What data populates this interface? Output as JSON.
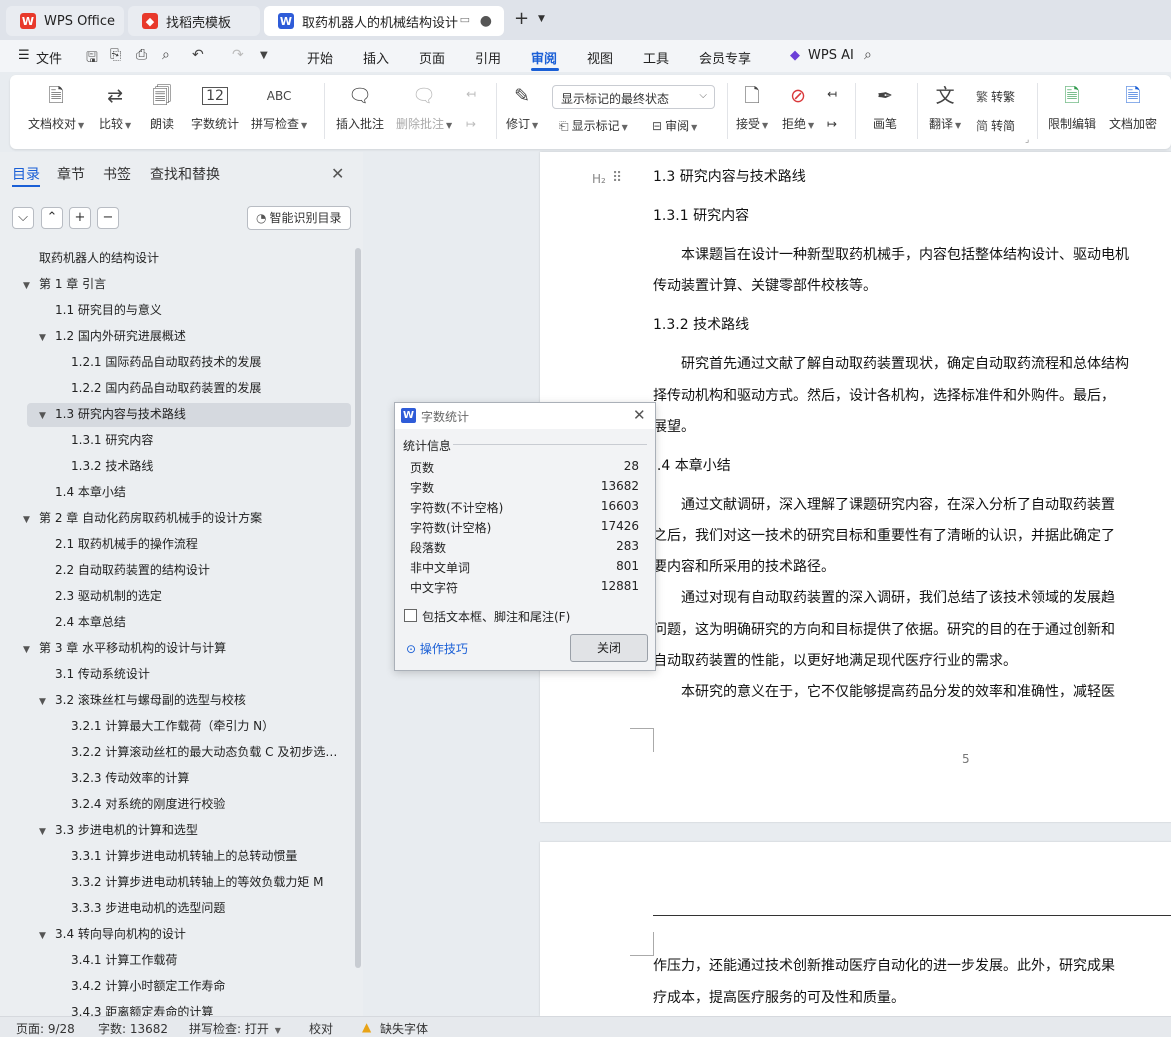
{
  "tabs": [
    {
      "label": "WPS Office",
      "icon": "wps-logo-icon"
    },
    {
      "label": "找稻壳模板",
      "icon": "docer-icon"
    },
    {
      "label": "取药机器人的机械结构设计 说",
      "icon": "word-doc-icon"
    }
  ],
  "menu": {
    "file": "文件",
    "items": [
      "开始",
      "插入",
      "页面",
      "引用",
      "审阅",
      "视图",
      "工具",
      "会员专享"
    ],
    "active": "审阅",
    "ai": "WPS AI"
  },
  "ribbon": {
    "doc_check": "文档校对",
    "compare": "比较",
    "read_aloud": "朗读",
    "word_count": "字数统计",
    "spell_check": "拼写检查",
    "insert_comment": "插入批注",
    "delete_comment": "删除批注",
    "revise": "修订",
    "mark_state": "显示标记的最终状态",
    "show_marks": "显示标记",
    "review": "审阅",
    "accept": "接受",
    "reject": "拒绝",
    "pen": "画笔",
    "translate": "翻译",
    "to_traditional": "转繁",
    "to_simplified": "转简",
    "restrict_edit": "限制编辑",
    "encrypt": "文档加密",
    "wordcount_icon_text": "12",
    "spell_icon_text": "ABC"
  },
  "sidebar": {
    "tabs": [
      "目录",
      "章节",
      "书签",
      "查找和替换"
    ],
    "smart_toc": "智能识别目录",
    "toc": [
      {
        "text": "取药机器人的结构设计",
        "level": 0,
        "arrow": ""
      },
      {
        "text": "第 1 章  引言",
        "level": 0,
        "arrow": "▼"
      },
      {
        "text": "1.1  研究目的与意义",
        "level": 1,
        "arrow": ""
      },
      {
        "text": "1.2  国内外研究进展概述",
        "level": 1,
        "arrow": "▼"
      },
      {
        "text": "1.2.1  国际药品自动取药技术的发展",
        "level": 2,
        "arrow": ""
      },
      {
        "text": "1.2.2  国内药品自动取药装置的发展",
        "level": 2,
        "arrow": ""
      },
      {
        "text": "1.3  研究内容与技术路线",
        "level": 1,
        "arrow": "▼"
      },
      {
        "text": "1.3.1  研究内容",
        "level": 2,
        "arrow": ""
      },
      {
        "text": "1.3.2  技术路线",
        "level": 2,
        "arrow": ""
      },
      {
        "text": "1.4  本章小结",
        "level": 1,
        "arrow": ""
      },
      {
        "text": "第 2 章  自动化药房取药机械手的设计方案",
        "level": 0,
        "arrow": "▼"
      },
      {
        "text": "2.1  取药机械手的操作流程",
        "level": 1,
        "arrow": ""
      },
      {
        "text": "2.2  自动取药装置的结构设计",
        "level": 1,
        "arrow": ""
      },
      {
        "text": "2.3  驱动机制的选定",
        "level": 1,
        "arrow": ""
      },
      {
        "text": "2.4  本章总结",
        "level": 1,
        "arrow": ""
      },
      {
        "text": "第 3 章  水平移动机构的设计与计算",
        "level": 0,
        "arrow": "▼"
      },
      {
        "text": "3.1  传动系统设计",
        "level": 1,
        "arrow": ""
      },
      {
        "text": "3.2  滚珠丝杠与螺母副的选型与校核",
        "level": 1,
        "arrow": "▼"
      },
      {
        "text": "3.2.1  计算最大工作载荷（牵引力 N）",
        "level": 2,
        "arrow": ""
      },
      {
        "text": "3.2.2  计算滚动丝杠的最大动态负载 C 及初步选…",
        "level": 2,
        "arrow": ""
      },
      {
        "text": "3.2.3  传动效率的计算",
        "level": 2,
        "arrow": ""
      },
      {
        "text": "3.2.4 对系统的刚度进行校验",
        "level": 2,
        "arrow": ""
      },
      {
        "text": "3.3 步进电机的计算和选型",
        "level": 1,
        "arrow": "▼"
      },
      {
        "text": "3.3.1 计算步进电动机转轴上的总转动惯量",
        "level": 2,
        "arrow": ""
      },
      {
        "text": "3.3.2 计算步进电动机转轴上的等效负载力矩 M",
        "level": 2,
        "arrow": ""
      },
      {
        "text": "3.3.3 步进电动机的选型问题",
        "level": 2,
        "arrow": ""
      },
      {
        "text": "3.4 转向导向机构的设计",
        "level": 1,
        "arrow": "▼"
      },
      {
        "text": "3.4.1 计算工作载荷",
        "level": 2,
        "arrow": ""
      },
      {
        "text": "3.4.2 计算小时额定工作寿命",
        "level": 2,
        "arrow": ""
      },
      {
        "text": "3.4.3 距离额定寿命的计算",
        "level": 2,
        "arrow": ""
      }
    ]
  },
  "document": {
    "heading_marker": "H₂",
    "page1": [
      {
        "type": "h",
        "text": "1.3  研究内容与技术路线"
      },
      {
        "type": "h",
        "text": "1.3.1  研究内容"
      },
      {
        "type": "p",
        "text": "本课题旨在设计一种新型取药机械手，内容包括整体结构设计、驱动电机"
      },
      {
        "type": "c",
        "text": "传动装置计算、关键零部件校核等。"
      },
      {
        "type": "h",
        "text": "1.3.2  技术路线"
      },
      {
        "type": "p",
        "text": "研究首先通过文献了解自动取药装置现状，确定自动取药流程和总体结构"
      },
      {
        "type": "c",
        "text": "择传动机构和驱动方式。然后，设计各机构，选择标准件和外购件。最后，"
      },
      {
        "type": "c",
        "text": "展望。"
      },
      {
        "type": "h",
        "text": "1.4  本章小结"
      },
      {
        "type": "p",
        "text": "通过文献调研，深入理解了课题研究内容，在深入分析了自动取药装置"
      },
      {
        "type": "c",
        "text": "之后，我们对这一技术的研究目标和重要性有了清晰的认识，并据此确定了"
      },
      {
        "type": "c",
        "text": "要内容和所采用的技术路径。"
      },
      {
        "type": "p",
        "text": "通过对现有自动取药装置的深入调研，我们总结了该技术领域的发展趋"
      },
      {
        "type": "c",
        "text": "问题，这为明确研究的方向和目标提供了依据。研究的目的在于通过创新和"
      },
      {
        "type": "c",
        "text": "自动取药装置的性能，以更好地满足现代医疗行业的需求。"
      },
      {
        "type": "p",
        "text": "本研究的意义在于，它不仅能够提高药品分发的效率和准确性，减轻医"
      }
    ],
    "page_number": "5",
    "page2": [
      "作压力，还能通过技术创新推动医疗自动化的进一步发展。此外，研究成果",
      "疗成本，提高医疗服务的可及性和质量。"
    ]
  },
  "dialog": {
    "title": "字数统计",
    "group": "统计信息",
    "stats": [
      {
        "label": "页数",
        "value": "28"
      },
      {
        "label": "字数",
        "value": "13682"
      },
      {
        "label": "字符数(不计空格)",
        "value": "16603"
      },
      {
        "label": "字符数(计空格)",
        "value": "17426"
      },
      {
        "label": "段落数",
        "value": "283"
      },
      {
        "label": "非中文单词",
        "value": "801"
      },
      {
        "label": "中文字符",
        "value": "12881"
      }
    ],
    "include_label": "包括文本框、脚注和尾注(F)",
    "tips": "操作技巧",
    "close": "关闭"
  },
  "status": {
    "page": "页面: 9/28",
    "words": "字数: 13682",
    "spell": "拼写检查: 打开",
    "proof": "校对",
    "missing_font": "缺失字体"
  },
  "colors": {
    "accent": "#1a5fd6",
    "wps_red": "#e8392b",
    "word_blue": "#2f5cd8",
    "warning": "#e8a317"
  }
}
